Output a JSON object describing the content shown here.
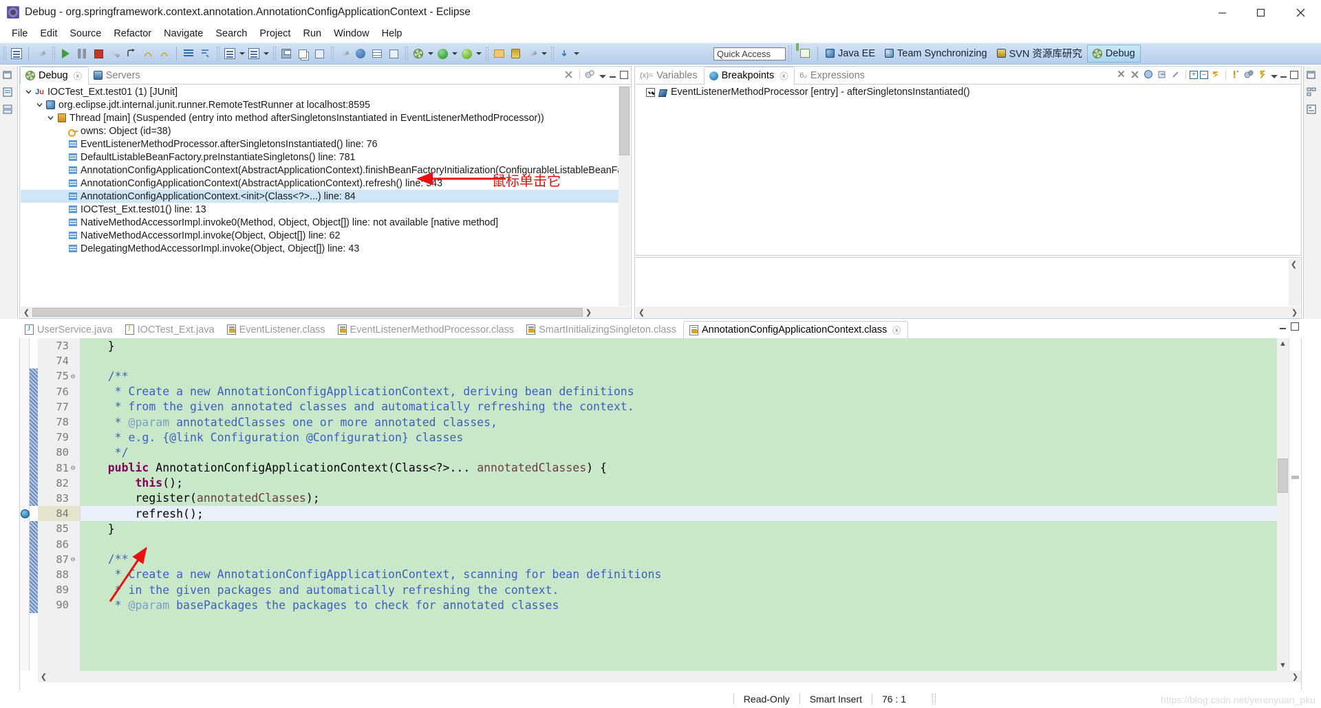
{
  "window": {
    "title": "Debug - org.springframework.context.annotation.AnnotationConfigApplicationContext - Eclipse",
    "app_icon": "eclipse-icon",
    "minimize": "—",
    "maximize": "❐",
    "close": "✕"
  },
  "menubar": {
    "items": [
      "File",
      "Edit",
      "Source",
      "Refactor",
      "Navigate",
      "Search",
      "Project",
      "Run",
      "Window",
      "Help"
    ]
  },
  "toolbar": {
    "quick_access_placeholder": "Quick Access",
    "quick_access_value": "",
    "buttons": [
      "new-wizard-icon",
      "link-icon",
      "resume-icon",
      "suspend-icon",
      "terminate-icon",
      "disconnect-icon",
      "step-return-icon",
      "step-over-icon",
      "step-into-icon",
      "instruction-stepping-icon",
      "drop-to-frame-icon",
      "new-file-icon",
      "new-class-icon",
      "save-icon",
      "save-all-icon",
      "print-icon",
      "toggle-mark-occurrences-icon",
      "external-tools-icon",
      "open-type-icon",
      "search-icon",
      "debug-config-icon",
      "run-config-icon",
      "coverage-icon",
      "profile-icon",
      "open-perspective-icon",
      "pin-icon",
      "annotation-icon",
      "prev-annotation-icon"
    ]
  },
  "perspectives": {
    "open_icon": "open-perspective-icon",
    "items": [
      {
        "label": "Java EE",
        "icon": "java-ee-perspective-icon",
        "selected": false
      },
      {
        "label": "Team Synchronizing",
        "icon": "team-sync-perspective-icon",
        "selected": false
      },
      {
        "label": "SVN 资源库研究",
        "icon": "svn-perspective-icon",
        "selected": false
      },
      {
        "label": "Debug",
        "icon": "debug-perspective-icon",
        "selected": true
      }
    ]
  },
  "debug_view": {
    "tabs": [
      {
        "label": "Debug",
        "icon": "debug-icon",
        "active": true,
        "closable": true
      },
      {
        "label": "Servers",
        "icon": "servers-icon",
        "active": false,
        "closable": false
      }
    ],
    "toolbar": [
      "terminate-all-icon",
      "remove-all-terminated-icon",
      "view-menu-icon",
      "minimize-icon",
      "maximize-icon"
    ],
    "tree": [
      {
        "indent": 0,
        "twisty": "expanded",
        "icon": "junit-launch-icon",
        "label": "IOCTest_Ext.test01 (1) [JUnit]",
        "selected": false
      },
      {
        "indent": 1,
        "twisty": "expanded",
        "icon": "debug-target-icon",
        "label": "org.eclipse.jdt.internal.junit.runner.RemoteTestRunner at localhost:8595",
        "selected": false
      },
      {
        "indent": 2,
        "twisty": "expanded",
        "icon": "thread-icon",
        "label": "Thread [main] (Suspended (entry into method afterSingletonsInstantiated in EventListenerMethodProcessor))",
        "selected": false
      },
      {
        "indent": 3,
        "twisty": "none",
        "icon": "monitor-key-icon",
        "label": "owns: Object  (id=38)",
        "selected": false
      },
      {
        "indent": 3,
        "twisty": "none",
        "icon": "stack-frame-icon",
        "label": "EventListenerMethodProcessor.afterSingletonsInstantiated() line: 76",
        "selected": false
      },
      {
        "indent": 3,
        "twisty": "none",
        "icon": "stack-frame-icon",
        "label": "DefaultListableBeanFactory.preInstantiateSingletons() line: 781",
        "selected": false
      },
      {
        "indent": 3,
        "twisty": "none",
        "icon": "stack-frame-icon",
        "label": "AnnotationConfigApplicationContext(AbstractApplicationContext).finishBeanFactoryInitialization(ConfigurableListableBeanFactory) l",
        "selected": false
      },
      {
        "indent": 3,
        "twisty": "none",
        "icon": "stack-frame-icon",
        "label": "AnnotationConfigApplicationContext(AbstractApplicationContext).refresh() line: 543",
        "selected": false
      },
      {
        "indent": 3,
        "twisty": "none",
        "icon": "stack-frame-icon",
        "label": "AnnotationConfigApplicationContext.<init>(Class<?>...) line: 84",
        "selected": true
      },
      {
        "indent": 3,
        "twisty": "none",
        "icon": "stack-frame-icon",
        "label": "IOCTest_Ext.test01() line: 13",
        "selected": false
      },
      {
        "indent": 3,
        "twisty": "none",
        "icon": "stack-frame-icon",
        "label": "NativeMethodAccessorImpl.invoke0(Method, Object, Object[]) line: not available [native method]",
        "selected": false
      },
      {
        "indent": 3,
        "twisty": "none",
        "icon": "stack-frame-icon",
        "label": "NativeMethodAccessorImpl.invoke(Object, Object[]) line: 62",
        "selected": false
      },
      {
        "indent": 3,
        "twisty": "none",
        "icon": "stack-frame-icon",
        "label": "DelegatingMethodAccessorImpl.invoke(Object, Object[]) line: 43",
        "selected": false
      }
    ]
  },
  "breakpoints_view": {
    "tabs": [
      {
        "label": "Variables",
        "icon": "variables-icon",
        "active": false,
        "closable": false
      },
      {
        "label": "Breakpoints",
        "icon": "breakpoints-icon",
        "active": true,
        "closable": true
      },
      {
        "label": "Expressions",
        "icon": "expressions-icon",
        "active": false,
        "closable": false
      }
    ],
    "toolbar": [
      "remove-breakpoint-icon",
      "remove-all-breakpoints-icon",
      "link-to-debug-view-icon",
      "skip-breakpoints-icon",
      "expand-all-icon",
      "collapse-all-icon",
      "add-exception-breakpoint-icon",
      "breakpoint-properties-icon",
      "working-sets-icon",
      "breakpoint-types-icon",
      "view-menu-icon",
      "minimize-icon",
      "maximize-icon"
    ],
    "rows": [
      {
        "checked": true,
        "icon": "method-breakpoint-icon",
        "label": "EventListenerMethodProcessor [entry] - afterSingletonsInstantiated()"
      }
    ]
  },
  "editor": {
    "tabs": [
      {
        "label": "UserService.java",
        "icon": "java-file-icon",
        "active": false,
        "closable": false
      },
      {
        "label": "IOCTest_Ext.java",
        "icon": "java-file-warning-icon",
        "active": false,
        "closable": false
      },
      {
        "label": "EventListener.class",
        "icon": "class-file-icon",
        "active": false,
        "closable": false
      },
      {
        "label": "EventListenerMethodProcessor.class",
        "icon": "class-file-icon",
        "active": false,
        "closable": false
      },
      {
        "label": "SmartInitializingSingleton.class",
        "icon": "class-file-icon",
        "active": false,
        "closable": false
      },
      {
        "label": "AnnotationConfigApplicationContext.class",
        "icon": "class-file-icon",
        "active": true,
        "closable": true
      }
    ],
    "toolbar": [
      "minimize-icon",
      "maximize-icon"
    ],
    "breakpoint_line": 84,
    "highlight_line": 84,
    "lines": [
      {
        "num": 73,
        "fold": "",
        "tokens": [
          {
            "t": "    }",
            "c": "txt"
          }
        ]
      },
      {
        "num": 74,
        "fold": "",
        "tokens": [
          {
            "t": "",
            "c": "txt"
          }
        ]
      },
      {
        "num": 75,
        "fold": "⊖",
        "tokens": [
          {
            "t": "    /**",
            "c": "cmt"
          }
        ]
      },
      {
        "num": 76,
        "fold": "",
        "tokens": [
          {
            "t": "     * Create a new AnnotationConfigApplicationContext, deriving bean definitions",
            "c": "cmt"
          }
        ]
      },
      {
        "num": 77,
        "fold": "",
        "tokens": [
          {
            "t": "     * from the given annotated classes and automatically refreshing the context.",
            "c": "cmt"
          }
        ]
      },
      {
        "num": 78,
        "fold": "",
        "tokens": [
          {
            "t": "     * ",
            "c": "cmt"
          },
          {
            "t": "@param",
            "c": "cmtd"
          },
          {
            "t": " annotatedClasses one or more annotated classes,",
            "c": "cmt"
          }
        ]
      },
      {
        "num": 79,
        "fold": "",
        "tokens": [
          {
            "t": "     * e.g. {@link Configuration @Configuration} classes",
            "c": "cmt"
          }
        ]
      },
      {
        "num": 80,
        "fold": "",
        "tokens": [
          {
            "t": "     */",
            "c": "cmt"
          }
        ]
      },
      {
        "num": 81,
        "fold": "⊖",
        "tokens": [
          {
            "t": "    ",
            "c": "txt"
          },
          {
            "t": "public",
            "c": "k"
          },
          {
            "t": " AnnotationConfigApplicationContext(Class<?>... ",
            "c": "txt"
          },
          {
            "t": "annotatedClasses",
            "c": "pl"
          },
          {
            "t": ") {",
            "c": "txt"
          }
        ]
      },
      {
        "num": 82,
        "fold": "",
        "tokens": [
          {
            "t": "        ",
            "c": "txt"
          },
          {
            "t": "this",
            "c": "k"
          },
          {
            "t": "();",
            "c": "txt"
          }
        ]
      },
      {
        "num": 83,
        "fold": "",
        "tokens": [
          {
            "t": "        register(",
            "c": "txt"
          },
          {
            "t": "annotatedClasses",
            "c": "pl"
          },
          {
            "t": ");",
            "c": "txt"
          }
        ]
      },
      {
        "num": 84,
        "fold": "",
        "hl": true,
        "tokens": [
          {
            "t": "        refresh();",
            "c": "txt"
          }
        ]
      },
      {
        "num": 85,
        "fold": "",
        "tokens": [
          {
            "t": "    }",
            "c": "txt"
          }
        ]
      },
      {
        "num": 86,
        "fold": "",
        "tokens": [
          {
            "t": "",
            "c": "txt"
          }
        ]
      },
      {
        "num": 87,
        "fold": "⊖",
        "tokens": [
          {
            "t": "    /**",
            "c": "cmt"
          }
        ]
      },
      {
        "num": 88,
        "fold": "",
        "tokens": [
          {
            "t": "     * Create a new AnnotationConfigApplicationContext, scanning for bean definitions",
            "c": "cmt"
          }
        ]
      },
      {
        "num": 89,
        "fold": "",
        "tokens": [
          {
            "t": "     * in the given packages and automatically refreshing the context.",
            "c": "cmt"
          }
        ]
      },
      {
        "num": 90,
        "fold": "",
        "tokens": [
          {
            "t": "     * ",
            "c": "cmt"
          },
          {
            "t": "@param",
            "c": "cmtd"
          },
          {
            "t": " basePackages the packages to check for annotated classes",
            "c": "cmt"
          }
        ]
      }
    ]
  },
  "annotations": {
    "arrow_color": "#e81010",
    "note1": "鼠标单击它"
  },
  "statusbar": {
    "readonly": "Read-Only",
    "insert_mode": "Smart Insert",
    "cursor_position": "76 : 1",
    "watermark": "https://blog.csdn.net/yerenyuan_pku"
  },
  "colors": {
    "code_background": "#c9e8c9",
    "highlight_line": "#e9f0fb",
    "selection": "#cfe6f7",
    "keyword": "#7f0055",
    "comment": "#3f5fbf",
    "toolbar_gradient_top": "#d4e3f5",
    "accent_blue": "#a9d4ee"
  }
}
